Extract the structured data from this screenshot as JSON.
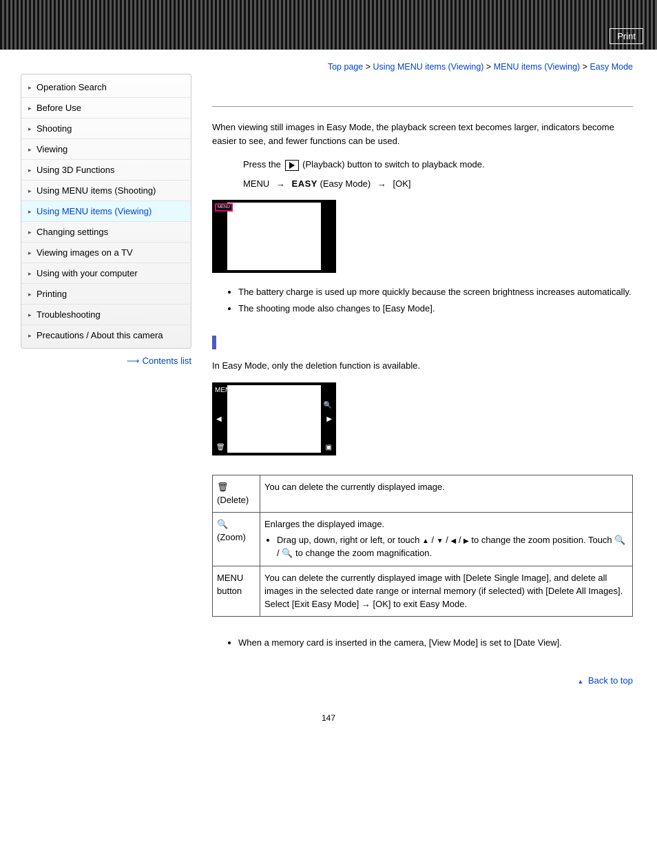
{
  "header": {
    "print": "Print"
  },
  "sidebar": {
    "items": [
      "Operation Search",
      "Before Use",
      "Shooting",
      "Viewing",
      "Using 3D Functions",
      "Using MENU items (Shooting)",
      "Using MENU items (Viewing)",
      "Changing settings",
      "Viewing images on a TV",
      "Using with your computer",
      "Printing",
      "Troubleshooting",
      "Precautions / About this camera"
    ],
    "active_index": 6,
    "contents_link": "Contents list"
  },
  "breadcrumb": {
    "parts": [
      "Top page",
      "Using MENU items (Viewing)",
      "MENU items (Viewing)",
      "Easy Mode"
    ],
    "sep": " > "
  },
  "intro": "When viewing still images in Easy Mode, the playback screen text becomes larger, indicators become easier to see, and fewer functions can be used.",
  "step1_prefix": "Press the ",
  "step1_suffix": " (Playback) button to switch to playback mode.",
  "step2_menu": "MENU",
  "step2_easy": "EASY",
  "step2_easy_paren": " (Easy Mode) ",
  "step2_ok": " [OK]",
  "screenshot_menu_label": "MENU",
  "bullets1": [
    "The battery charge is used up more quickly because the screen brightness increases automatically.",
    "The shooting mode also changes to [Easy Mode]."
  ],
  "section2_intro": "In Easy Mode, only the deletion function is available.",
  "table": {
    "rows": [
      {
        "label_icon": "trash",
        "label_text": "(Delete)",
        "desc": "You can delete the currently displayed image."
      },
      {
        "label_icon": "zoom",
        "label_text": "(Zoom)",
        "desc_line1": "Enlarges the displayed image.",
        "desc_line2_a": "Drag up, down, right or left, or touch ",
        "desc_line2_b": " to change the zoom position. Touch ",
        "desc_line2_c": " to change the zoom magnification."
      },
      {
        "label_text_a": "MENU",
        "label_text_b": "button",
        "desc_a": "You can delete the currently displayed image with [Delete Single Image], and delete all images in the selected date range or internal memory (if selected) with [Delete All Images].",
        "desc_b_prefix": "Select [Exit Easy Mode] ",
        "desc_b_suffix": " [OK] to exit Easy Mode."
      }
    ]
  },
  "note": "When a memory card is inserted in the camera, [View Mode] is set to [Date View].",
  "back_to_top": "Back to top",
  "page_number": "147"
}
